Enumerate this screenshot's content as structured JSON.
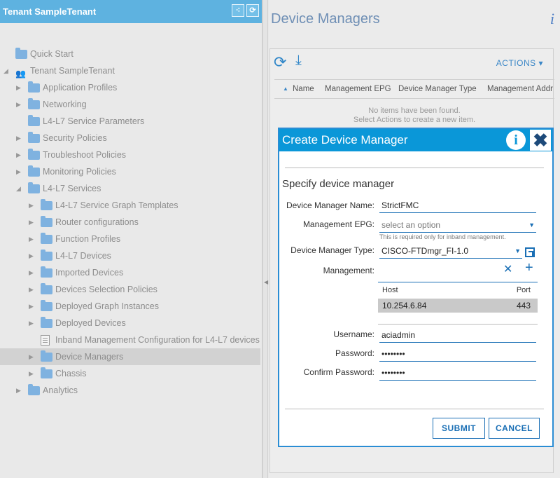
{
  "left_header": {
    "title": "Tenant SampleTenant"
  },
  "tree": [
    {
      "label": "Quick Start",
      "level": 0,
      "arrow": "",
      "icon": "folder-icon"
    },
    {
      "label": "Tenant SampleTenant",
      "level": 0,
      "arrow": "expanded",
      "icon": "users-icon"
    },
    {
      "label": "Application Profiles",
      "level": 1,
      "arrow": "collapsed",
      "icon": "folder-icon"
    },
    {
      "label": "Networking",
      "level": 1,
      "arrow": "collapsed",
      "icon": "folder-icon"
    },
    {
      "label": "L4-L7 Service Parameters",
      "level": 1,
      "arrow": "",
      "icon": "folder-icon"
    },
    {
      "label": "Security Policies",
      "level": 1,
      "arrow": "collapsed",
      "icon": "folder-icon"
    },
    {
      "label": "Troubleshoot Policies",
      "level": 1,
      "arrow": "collapsed",
      "icon": "folder-icon"
    },
    {
      "label": "Monitoring Policies",
      "level": 1,
      "arrow": "collapsed",
      "icon": "folder-icon"
    },
    {
      "label": "L4-L7 Services",
      "level": 1,
      "arrow": "expanded",
      "icon": "folder-icon"
    },
    {
      "label": "L4-L7 Service Graph Templates",
      "level": 2,
      "arrow": "collapsed",
      "icon": "folder-icon"
    },
    {
      "label": "Router configurations",
      "level": 2,
      "arrow": "collapsed",
      "icon": "folder-icon"
    },
    {
      "label": "Function Profiles",
      "level": 2,
      "arrow": "collapsed",
      "icon": "folder-icon"
    },
    {
      "label": "L4-L7 Devices",
      "level": 2,
      "arrow": "collapsed",
      "icon": "folder-icon"
    },
    {
      "label": "Imported Devices",
      "level": 2,
      "arrow": "collapsed",
      "icon": "folder-icon"
    },
    {
      "label": "Devices Selection Policies",
      "level": 2,
      "arrow": "collapsed",
      "icon": "folder-icon"
    },
    {
      "label": "Deployed Graph Instances",
      "level": 2,
      "arrow": "collapsed",
      "icon": "folder-icon"
    },
    {
      "label": "Deployed Devices",
      "level": 2,
      "arrow": "collapsed",
      "icon": "folder-icon"
    },
    {
      "label": "Inband Management Configuration for L4-L7 devices",
      "level": 2,
      "arrow": "",
      "icon": "document-icon"
    },
    {
      "label": "Device Managers",
      "level": 2,
      "arrow": "collapsed",
      "icon": "folder-icon",
      "selected": true
    },
    {
      "label": "Chassis",
      "level": 2,
      "arrow": "collapsed",
      "icon": "folder-icon"
    },
    {
      "label": "Analytics",
      "level": 1,
      "arrow": "collapsed",
      "icon": "folder-icon"
    }
  ],
  "main": {
    "title": "Device Managers",
    "actions_label": "ACTIONS",
    "columns": [
      "Name",
      "Management EPG",
      "Device Manager Type",
      "Management Addr"
    ],
    "empty_line1": "No items have been found.",
    "empty_line2": "Select Actions to create a new item."
  },
  "modal": {
    "title": "Create Device Manager",
    "subtitle": "Specify device manager",
    "fields": {
      "name_label": "Device Manager Name:",
      "name_value": "StrictFMC",
      "epg_label": "Management EPG:",
      "epg_placeholder": "select an option",
      "epg_hint": "This is required only for inband management.",
      "type_label": "Device Manager Type:",
      "type_value": "CISCO-FTDmgr_FI-1.0",
      "mgmt_label": "Management:",
      "username_label": "Username:",
      "username_value": "aciadmin",
      "password_label": "Password:",
      "password_value": "••••••••",
      "confirm_label": "Confirm Password:",
      "confirm_value": "••••••••"
    },
    "management_table": {
      "columns": [
        "Host",
        "Port"
      ],
      "rows": [
        {
          "host": "10.254.6.84",
          "port": "443"
        }
      ]
    },
    "submit_label": "SUBMIT",
    "cancel_label": "CANCEL"
  },
  "colors": {
    "header_blue": "#5eb2e0",
    "modal_header": "#0a97d8",
    "accent": "#1a6fb5",
    "folder": "#7fb2e0"
  }
}
